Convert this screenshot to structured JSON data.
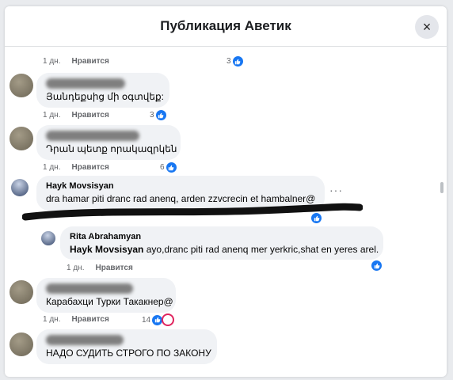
{
  "dialog": {
    "title": "Публикация Аветик",
    "close_icon": "×"
  },
  "comments": [
    {
      "time": "1 дн.",
      "like": "Нравится",
      "count": "3"
    },
    {
      "text": "Յանդեքսից մի օգտվեք:",
      "time": "1 дн.",
      "like": "Нравится",
      "count": "3"
    },
    {
      "text": "Դրան պետք որակազրկեն",
      "time": "1 дн.",
      "like": "Нравится",
      "count": "6"
    },
    {
      "name": "Hayk Movsisyan",
      "text": "dra hamar piti dranc rad anenq, arden zzvcrecin et hambalner@"
    },
    {
      "name": "Rita Abrahamyan",
      "mention": "Hayk Movsisyan",
      "text": " ayo,dranc piti rad anenq mer yerkric,shat en yeres arel.",
      "time": "1 дн.",
      "like": "Нравится"
    },
    {
      "text": "Карабахци Турки Такакнер@",
      "time": "1 дн.",
      "like": "Нравится",
      "count": "14"
    },
    {
      "text": "НАДО СУДИТЬ СТРОГО ПО ЗАКОНУ"
    }
  ],
  "colors": {
    "accent": "#1877f2",
    "angry": "#e0245e"
  }
}
